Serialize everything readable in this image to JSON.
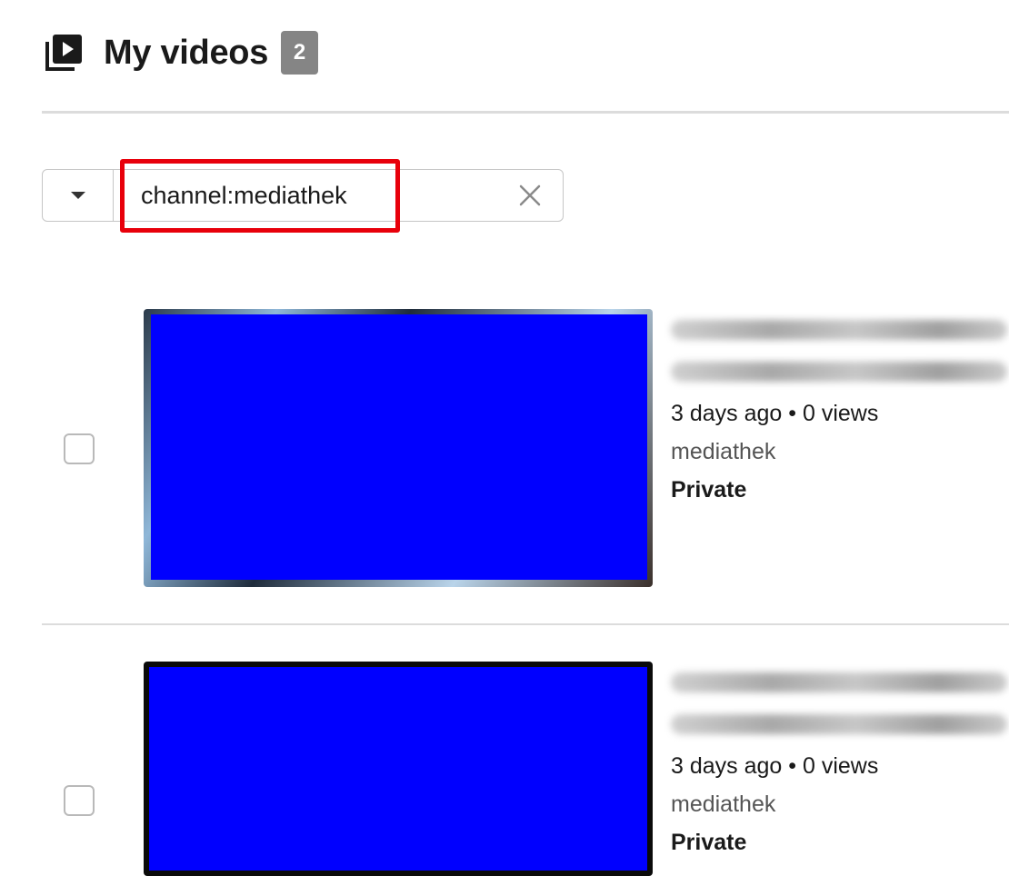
{
  "header": {
    "title": "My videos",
    "count": "2",
    "icon": "video-library-icon"
  },
  "filter": {
    "value": "channel:mediathek",
    "dropdown_icon": "caret-down-icon",
    "clear_icon": "close-icon"
  },
  "videos": [
    {
      "time_ago": "3 days ago",
      "separator": "•",
      "views": "0 views",
      "channel": "mediathek",
      "visibility": "Private"
    },
    {
      "time_ago": "3 days ago",
      "separator": "•",
      "views": "0 views",
      "channel": "mediathek",
      "visibility": "Private"
    }
  ],
  "colors": {
    "highlight": "#e8000b",
    "thumbnail_fill": "#0000ff",
    "badge": "#858585"
  }
}
